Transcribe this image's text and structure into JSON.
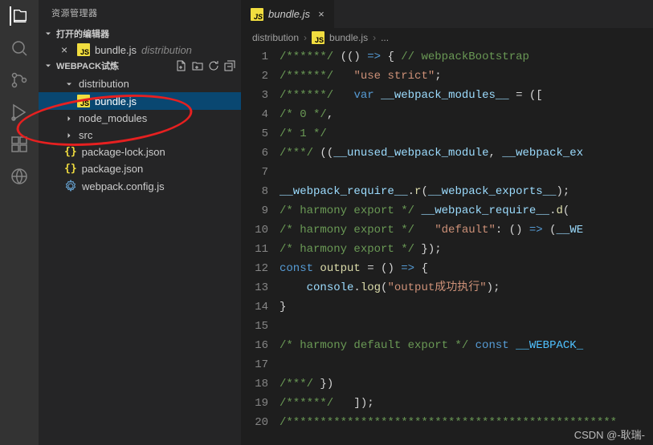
{
  "sidebar": {
    "title": "资源管理器",
    "openEditorsHeader": "打开的编辑器",
    "openEditor": {
      "name": "bundle.js",
      "path": "distribution"
    },
    "projectHeader": "WEBPACK试炼",
    "items": [
      {
        "type": "folder",
        "name": "distribution",
        "depth": 1,
        "expanded": true
      },
      {
        "type": "file",
        "name": "bundle.js",
        "depth": 2,
        "icon": "js",
        "active": true
      },
      {
        "type": "folder",
        "name": "node_modules",
        "depth": 1,
        "expanded": false
      },
      {
        "type": "folder",
        "name": "src",
        "depth": 1,
        "expanded": false
      },
      {
        "type": "file",
        "name": "package-lock.json",
        "depth": 1,
        "icon": "json"
      },
      {
        "type": "file",
        "name": "package.json",
        "depth": 1,
        "icon": "json"
      },
      {
        "type": "file",
        "name": "webpack.config.js",
        "depth": 1,
        "icon": "gear"
      }
    ]
  },
  "tab": {
    "name": "bundle.js"
  },
  "breadcrumbs": {
    "folder": "distribution",
    "file": "bundle.js",
    "more": "..."
  },
  "code": {
    "lines": [
      [
        [
          "c-comment",
          "/******/"
        ],
        [
          "c-punc",
          " (() "
        ],
        [
          "c-keyword",
          "=>"
        ],
        [
          "c-punc",
          " { "
        ],
        [
          "c-comment",
          "// webpackBootstrap"
        ]
      ],
      [
        [
          "c-comment",
          "/******/"
        ],
        [
          "c-punc",
          "   "
        ],
        [
          "c-string",
          "\"use strict\""
        ],
        [
          "c-punc",
          ";"
        ]
      ],
      [
        [
          "c-comment",
          "/******/"
        ],
        [
          "c-punc",
          "   "
        ],
        [
          "c-keyword",
          "var"
        ],
        [
          "c-punc",
          " "
        ],
        [
          "c-var",
          "__webpack_modules__"
        ],
        [
          "c-punc",
          " = (["
        ]
      ],
      [
        [
          "c-comment",
          "/* 0 */"
        ],
        [
          "c-punc",
          ","
        ]
      ],
      [
        [
          "c-comment",
          "/* 1 */"
        ]
      ],
      [
        [
          "c-comment",
          "/***/"
        ],
        [
          "c-punc",
          " (("
        ],
        [
          "c-var",
          "__unused_webpack_module"
        ],
        [
          "c-punc",
          ", "
        ],
        [
          "c-var",
          "__webpack_ex"
        ]
      ],
      [],
      [
        [
          "c-var",
          "__webpack_require__"
        ],
        [
          "c-punc",
          "."
        ],
        [
          "c-func",
          "r"
        ],
        [
          "c-punc",
          "("
        ],
        [
          "c-var",
          "__webpack_exports__"
        ],
        [
          "c-punc",
          ");"
        ]
      ],
      [
        [
          "c-comment",
          "/* harmony export */"
        ],
        [
          "c-punc",
          " "
        ],
        [
          "c-var",
          "__webpack_require__"
        ],
        [
          "c-punc",
          "."
        ],
        [
          "c-func",
          "d"
        ],
        [
          "c-punc",
          "("
        ]
      ],
      [
        [
          "c-comment",
          "/* harmony export */"
        ],
        [
          "c-punc",
          "   "
        ],
        [
          "c-string",
          "\"default\""
        ],
        [
          "c-punc",
          ": () "
        ],
        [
          "c-keyword",
          "=>"
        ],
        [
          "c-punc",
          " ("
        ],
        [
          "c-var",
          "__WE"
        ]
      ],
      [
        [
          "c-comment",
          "/* harmony export */"
        ],
        [
          "c-punc",
          " });"
        ]
      ],
      [
        [
          "c-keyword",
          "const"
        ],
        [
          "c-punc",
          " "
        ],
        [
          "c-func",
          "output"
        ],
        [
          "c-punc",
          " = () "
        ],
        [
          "c-keyword",
          "=>"
        ],
        [
          "c-punc",
          " {"
        ]
      ],
      [
        [
          "c-punc",
          "    "
        ],
        [
          "c-var",
          "console"
        ],
        [
          "c-punc",
          "."
        ],
        [
          "c-func",
          "log"
        ],
        [
          "c-punc",
          "("
        ],
        [
          "c-string",
          "\"output成功执行\""
        ],
        [
          "c-punc",
          ");"
        ]
      ],
      [
        [
          "c-punc",
          "}"
        ]
      ],
      [],
      [
        [
          "c-comment",
          "/* harmony default export */"
        ],
        [
          "c-punc",
          " "
        ],
        [
          "c-keyword",
          "const"
        ],
        [
          "c-punc",
          " "
        ],
        [
          "c-const",
          "__WEBPACK_"
        ]
      ],
      [],
      [
        [
          "c-comment",
          "/***/"
        ],
        [
          "c-punc",
          " })"
        ]
      ],
      [
        [
          "c-comment",
          "/******/"
        ],
        [
          "c-punc",
          "   ]);"
        ]
      ],
      [
        [
          "c-comment",
          "/*************************************************"
        ]
      ]
    ]
  },
  "watermark": "CSDN @-耿瑞-"
}
